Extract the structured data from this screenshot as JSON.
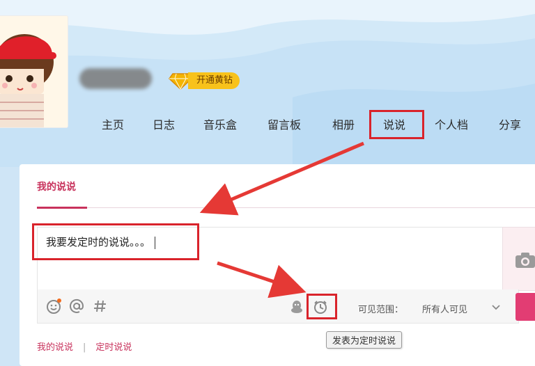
{
  "header": {
    "vip_label": "开通黄钻"
  },
  "nav": {
    "items": [
      {
        "label": "主页"
      },
      {
        "label": "日志"
      },
      {
        "label": "音乐盒"
      },
      {
        "label": "留言板"
      },
      {
        "label": "相册"
      },
      {
        "label": "说说"
      },
      {
        "label": "个人档"
      },
      {
        "label": "分享"
      }
    ],
    "active": "说说"
  },
  "panel": {
    "title": "我的说说",
    "input_text": "我要发定时的说说。。。",
    "visibility_label": "可见范围：",
    "visibility_value": "所有人可见",
    "tabs": [
      "我的说说",
      "定时说说"
    ],
    "separator": "|",
    "tooltip": "发表为定时说说"
  },
  "colors": {
    "accent": "#c8325c",
    "publish": "#e23d73",
    "annotation": "#d9232b",
    "header_bg": "#d3e9f8"
  },
  "icons": [
    "emoji-icon",
    "at-icon",
    "hashtag-icon",
    "qq-penguin-icon",
    "clock-icon",
    "camera-icon",
    "chevron-down-icon",
    "diamond-icon"
  ]
}
